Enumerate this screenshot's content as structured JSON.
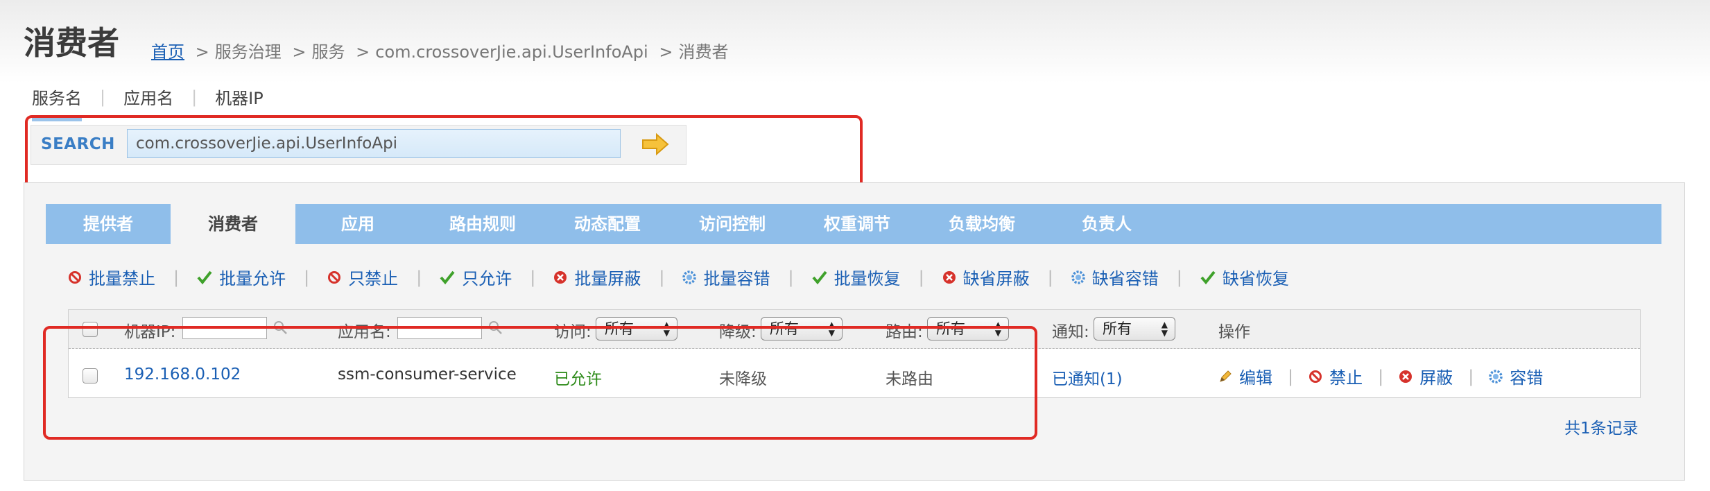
{
  "page": {
    "title": "消费者"
  },
  "breadcrumb": {
    "home": "首页",
    "sep": ">",
    "items": [
      "服务治理",
      "服务",
      "com.crossoverJie.api.UserInfoApi",
      "消费者"
    ]
  },
  "search": {
    "tabs": [
      "服务名",
      "应用名",
      "机器IP"
    ],
    "active_tab": "服务名",
    "label": "SEARCH",
    "value": "com.crossoverJie.api.UserInfoApi",
    "go_icon": "arrow-right-icon"
  },
  "tabs": [
    "提供者",
    "消费者",
    "应用",
    "路由规则",
    "动态配置",
    "访问控制",
    "权重调节",
    "负载均衡",
    "负责人"
  ],
  "active_tab": "消费者",
  "batch_actions": [
    {
      "label": "批量禁止",
      "icon": "forbid-icon"
    },
    {
      "label": "批量允许",
      "icon": "check-icon"
    },
    {
      "label": "只禁止",
      "icon": "forbid-icon"
    },
    {
      "label": "只允许",
      "icon": "check-icon"
    },
    {
      "label": "批量屏蔽",
      "icon": "block-icon"
    },
    {
      "label": "批量容错",
      "icon": "gear-icon"
    },
    {
      "label": "批量恢复",
      "icon": "check-icon"
    },
    {
      "label": "缺省屏蔽",
      "icon": "block-icon"
    },
    {
      "label": "缺省容错",
      "icon": "gear-icon"
    },
    {
      "label": "缺省恢复",
      "icon": "check-icon"
    }
  ],
  "table": {
    "headers": {
      "ip": "机器IP:",
      "app": "应用名:",
      "access": "访问:",
      "degrade": "降级:",
      "route": "路由:",
      "notify": "通知:",
      "ops": "操作"
    },
    "filters": {
      "access": "所有",
      "degrade": "所有",
      "route": "所有",
      "notify": "所有"
    },
    "rows": [
      {
        "ip": "192.168.0.102",
        "app": "ssm-consumer-service",
        "access": "已允许",
        "degrade": "未降级",
        "route": "未路由",
        "notify": "已通知(1)",
        "ops": [
          {
            "label": "编辑",
            "icon": "pencil-icon"
          },
          {
            "label": "禁止",
            "icon": "forbid-icon"
          },
          {
            "label": "屏蔽",
            "icon": "block-icon"
          },
          {
            "label": "容错",
            "icon": "gear-icon"
          }
        ]
      }
    ]
  },
  "total": "共1条记录",
  "colors": {
    "tab_bar": "#8fbeea",
    "link": "#1a5fb4",
    "allowed": "#2e8b1a",
    "highlight": "#e02a24"
  }
}
